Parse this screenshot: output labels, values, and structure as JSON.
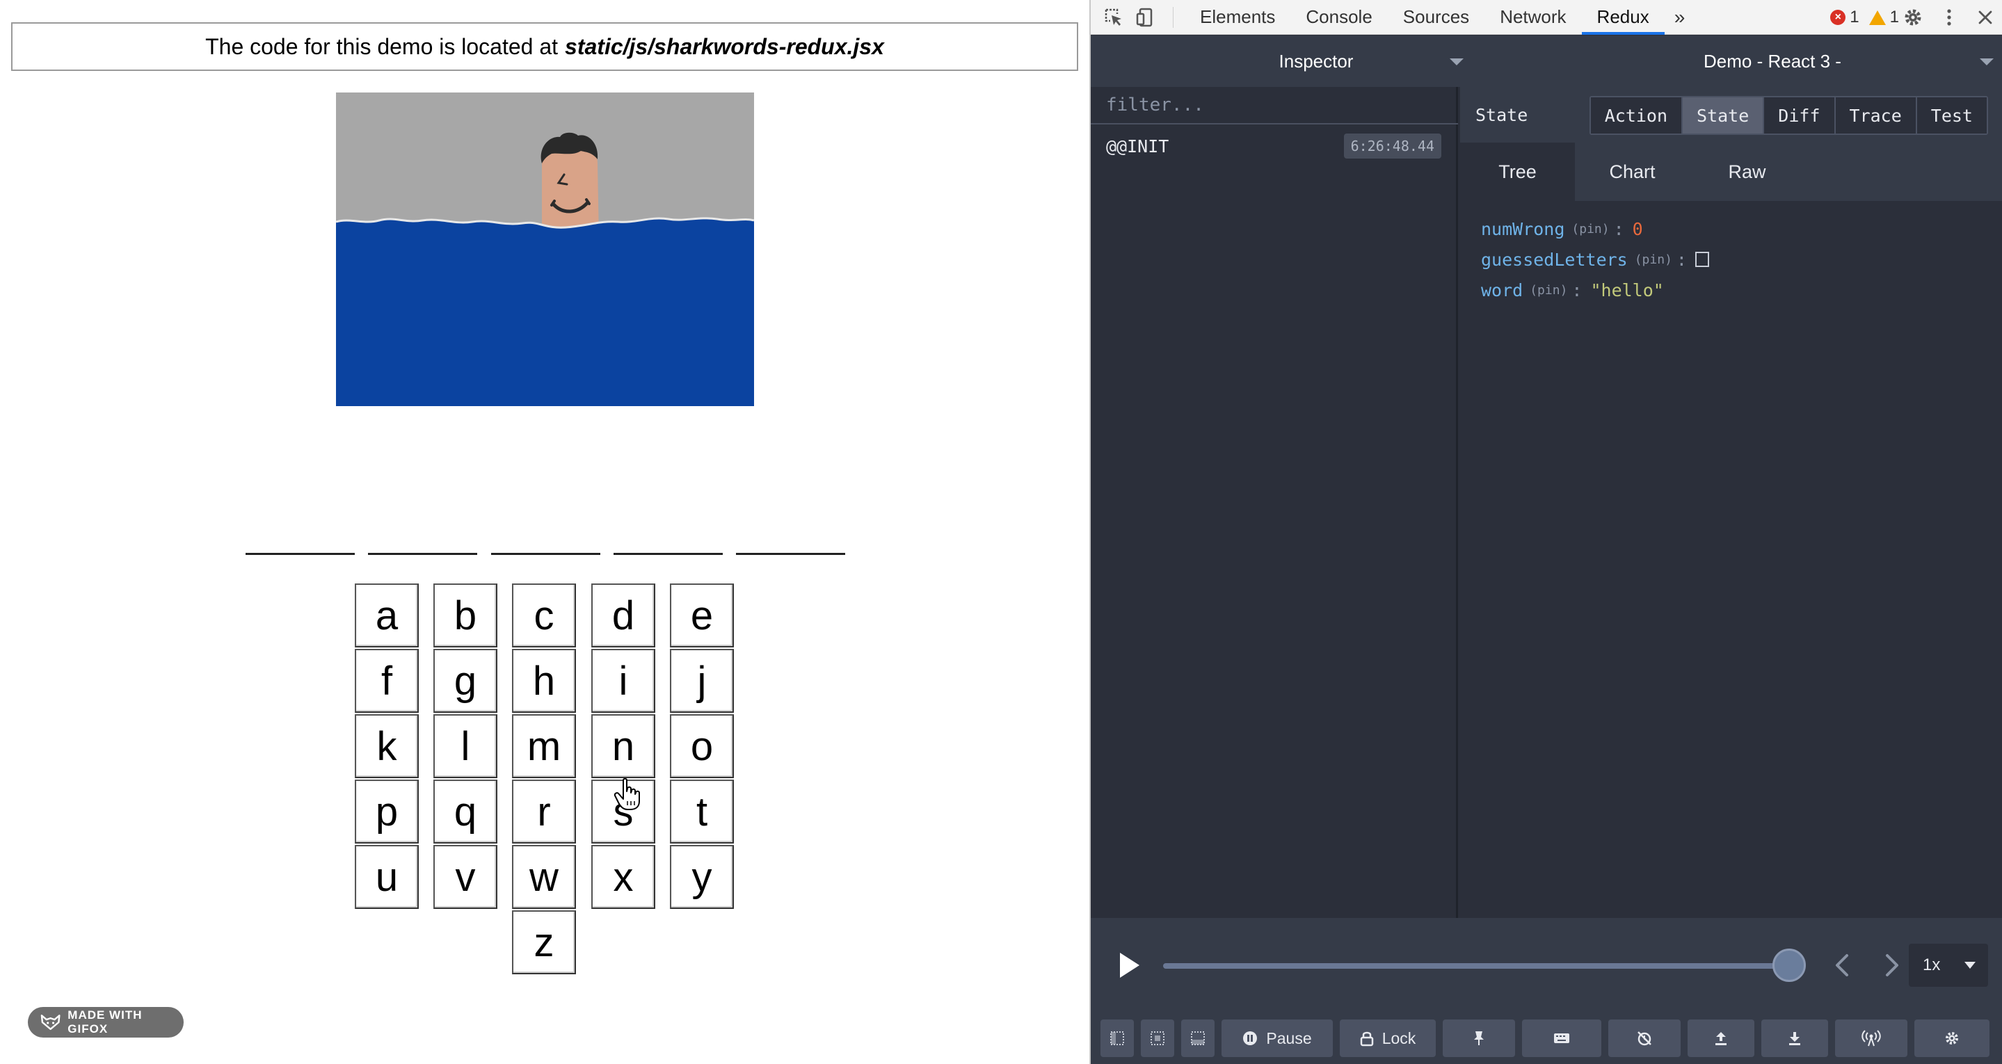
{
  "demo": {
    "banner_prefix": "The code for this demo is located at",
    "banner_path": "static/js/sharkwords-redux.jsx",
    "letters": [
      "a",
      "b",
      "c",
      "d",
      "e",
      "f",
      "g",
      "h",
      "i",
      "j",
      "k",
      "l",
      "m",
      "n",
      "o",
      "p",
      "q",
      "r",
      "s",
      "t",
      "u",
      "v",
      "w",
      "x",
      "y",
      "z"
    ],
    "blank_count": 5,
    "badge": "MADE WITH GIFOX"
  },
  "devtools": {
    "tabs": [
      "Elements",
      "Console",
      "Sources",
      "Network",
      "Redux"
    ],
    "active_tab": "Redux",
    "error_count": "1",
    "warning_count": "1"
  },
  "redux": {
    "monitor": "Inspector",
    "instance": "Demo - React 3 -",
    "filter_placeholder": "filter...",
    "actions": [
      {
        "name": "@@INIT",
        "time": "6:26:48.44"
      }
    ],
    "panel_title": "State",
    "panel_buttons": [
      "Action",
      "State",
      "Diff",
      "Trace",
      "Test"
    ],
    "active_panel_button": "State",
    "view_tabs": [
      "Tree",
      "Chart",
      "Raw"
    ],
    "active_view_tab": "Tree",
    "pin_label": "(pin)",
    "state": {
      "numWrong_key": "numWrong",
      "numWrong_value": "0",
      "guessedLetters_key": "guessedLetters",
      "word_key": "word",
      "word_value": "\"hello\""
    },
    "slider_position": 1.0,
    "speed": "1x",
    "footer": {
      "pause": "Pause",
      "lock": "Lock"
    }
  },
  "colors": {
    "devtools_bg": "#2b2f3a",
    "devtools_header": "#353b48",
    "state_key": "#6fb3e8",
    "state_number": "#e8693c",
    "state_string": "#c2c97a",
    "active_tab_underline": "#1a73e8",
    "sky": "#a7a7a7",
    "water": "#0b43a0"
  }
}
